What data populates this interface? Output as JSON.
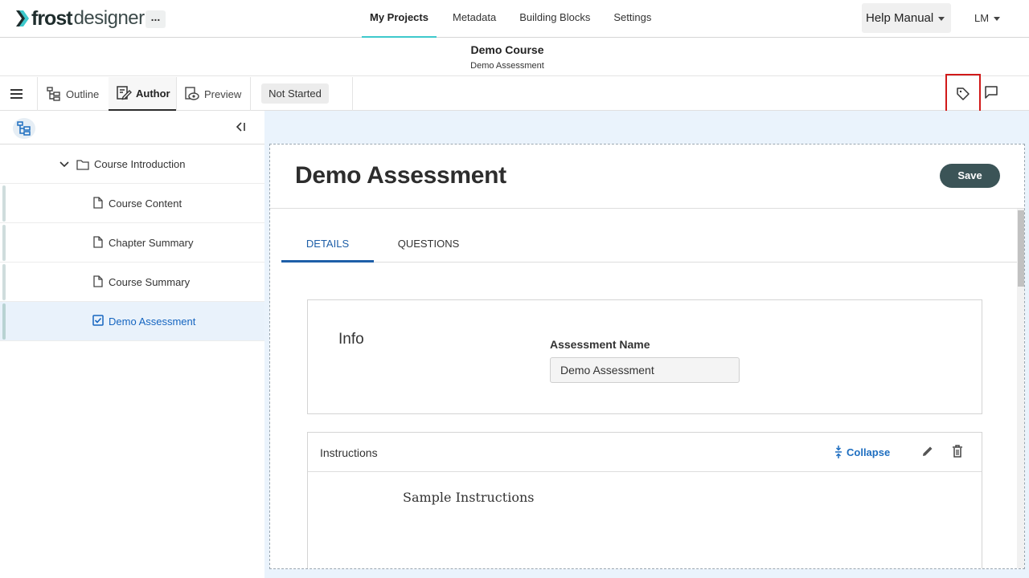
{
  "app": {
    "brand_bold": "frost",
    "brand_light": "designer",
    "more_label": "..."
  },
  "nav": {
    "links": [
      "My Projects",
      "Metadata",
      "Building Blocks",
      "Settings"
    ],
    "active": "My Projects",
    "help_label": "Help Manual",
    "user_initials": "LM"
  },
  "course": {
    "title": "Demo Course",
    "subtitle": "Demo Assessment"
  },
  "toolbar": {
    "outline_label": "Outline",
    "author_label": "Author",
    "preview_label": "Preview",
    "status": "Not Started"
  },
  "sidebar": {
    "items": [
      {
        "label": "Course Introduction",
        "type": "folder"
      },
      {
        "label": "Course Content",
        "type": "page"
      },
      {
        "label": "Chapter Summary",
        "type": "page"
      },
      {
        "label": "Course Summary",
        "type": "page"
      },
      {
        "label": "Demo Assessment",
        "type": "assessment",
        "selected": true
      }
    ]
  },
  "editor": {
    "title": "Demo Assessment",
    "save_label": "Save",
    "tabs": [
      "DETAILS",
      "QUESTIONS"
    ],
    "active_tab": "DETAILS",
    "info": {
      "title": "Info",
      "field_label": "Assessment Name",
      "field_value": "Demo Assessment"
    },
    "instructions": {
      "title": "Instructions",
      "collapse_label": "Collapse",
      "body": "Sample Instructions"
    }
  },
  "colors": {
    "accent": "#3ec9cc",
    "link": "#1e6ec0",
    "save_bg": "#3b5457",
    "highlight_box": "#d11a1a"
  }
}
